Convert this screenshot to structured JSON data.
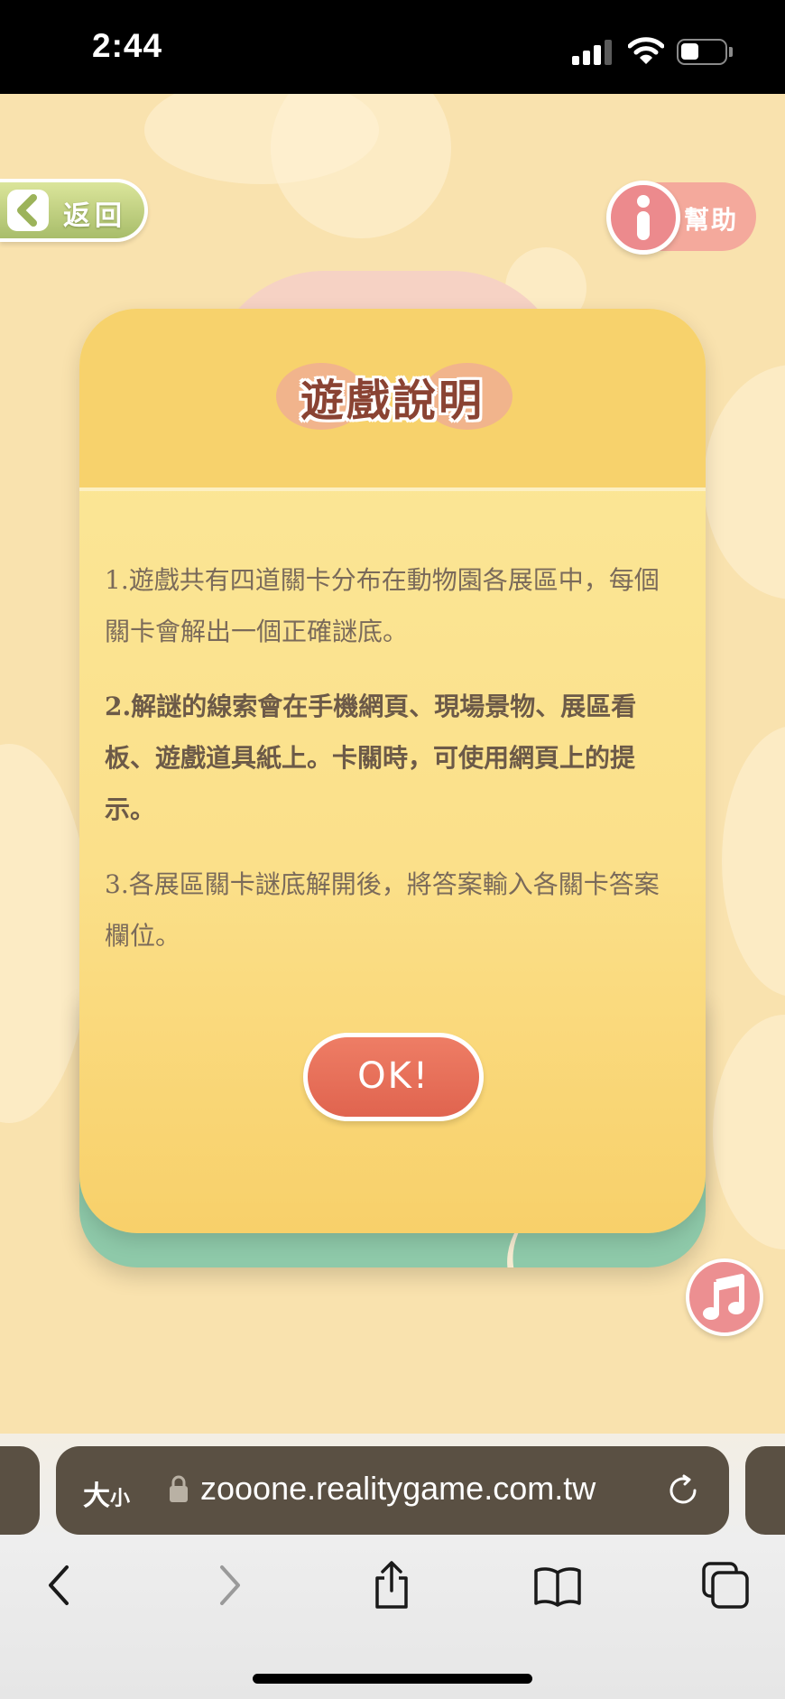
{
  "status_bar": {
    "time": "2:44"
  },
  "nav": {
    "back_label": "返回",
    "help_label": "幫助"
  },
  "dialog": {
    "title": "遊戲說明",
    "rules": [
      "1.遊戲共有四道關卡分布在動物園各展區中，每個關卡會解出一個正確謎底。",
      "2.解謎的線索會在手機網頁、現場景物、展區看板、遊戲道具紙上。卡關時，可使用網頁上的提示。",
      "3.各展區關卡謎底解開後，將答案輸入各關卡答案欄位。"
    ],
    "ok_label": "OK!"
  },
  "browser": {
    "text_size_label": "大",
    "text_size_small": "小",
    "url": "zooone.realitygame.com.tw"
  },
  "icons": {
    "back": "chevron-left-icon",
    "help": "info-icon",
    "music": "music-note-icon",
    "lock": "lock-icon",
    "reload": "reload-icon",
    "toolbar": [
      "back-arrow-icon",
      "forward-arrow-icon",
      "share-icon",
      "bookmarks-icon",
      "tabs-icon"
    ]
  },
  "colors": {
    "background": "#f9e2ae",
    "card": "#fbe08a",
    "ok_button": "#e8705a",
    "back_button": "#b5c777",
    "help_button": "#ec8a8d",
    "address_bar": "#5a5043"
  }
}
